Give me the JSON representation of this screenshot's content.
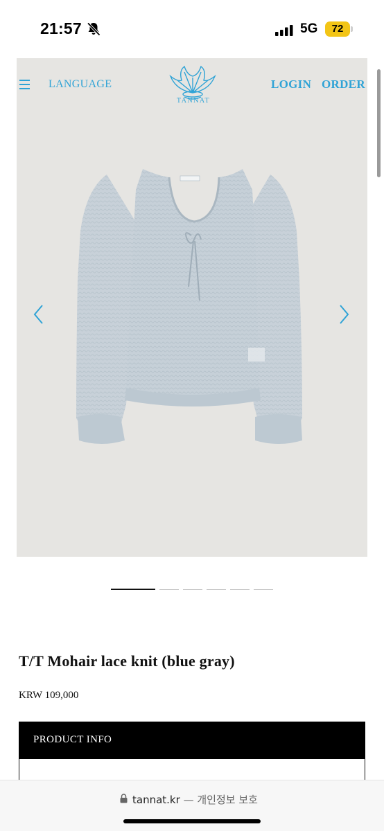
{
  "status_bar": {
    "time": "21:57",
    "bell_icon": "bell-slash-icon",
    "signal_icon": "cellular-signal-icon",
    "network": "5G",
    "battery": "72"
  },
  "header": {
    "menu_icon": "hamburger-menu-icon",
    "language": "LANGUAGE",
    "logo_text": "TANNAT",
    "login": "LOGIN",
    "order": "ORDER",
    "accent_color": "#2fa3d6"
  },
  "carousel": {
    "prev_icon": "chevron-left-icon",
    "next_icon": "chevron-right-icon",
    "slide_count": 6,
    "active_index": 0,
    "image_subject": "product-photo-knit-top"
  },
  "product": {
    "name": "T/T Mohair lace knit (blue gray)",
    "price": "KRW 109,000",
    "info_header": "PRODUCT INFO"
  },
  "browser": {
    "lock_icon": "lock-icon",
    "domain": "tannat.kr",
    "privacy": "— 개인정보 보호"
  }
}
